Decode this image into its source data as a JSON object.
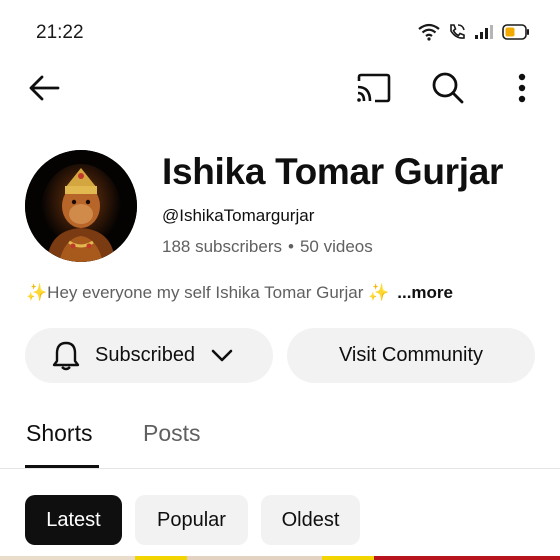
{
  "status_bar": {
    "time": "21:22"
  },
  "channel": {
    "name": "Ishika Tomar Gurjar",
    "handle": "@IshikaTomargurjar",
    "subscribers": "188 subscribers",
    "separator": "•",
    "videos": "50 videos",
    "description": "Hey  everyone my self Ishika Tomar Gurjar",
    "more": "...more"
  },
  "actions": {
    "subscribed_label": "Subscribed",
    "community_label": "Visit Community"
  },
  "tabs": [
    {
      "label": "Shorts",
      "active": true
    },
    {
      "label": "Posts",
      "active": false
    }
  ],
  "chips": [
    {
      "label": "Latest",
      "selected": true
    },
    {
      "label": "Popular",
      "selected": false
    },
    {
      "label": "Oldest",
      "selected": false
    }
  ],
  "colors": {
    "accent_dark": "#0f0f0f",
    "chip_bg": "#f2f2f2",
    "secondary_text": "#606060",
    "battery": "#f2a900",
    "sparkle": "#f3c93a"
  },
  "icons": {
    "back": "arrow-left-icon",
    "cast": "cast-icon",
    "search": "search-icon",
    "menu": "more-vert-icon",
    "bell": "bell-icon",
    "chevron": "chevron-down-icon"
  }
}
